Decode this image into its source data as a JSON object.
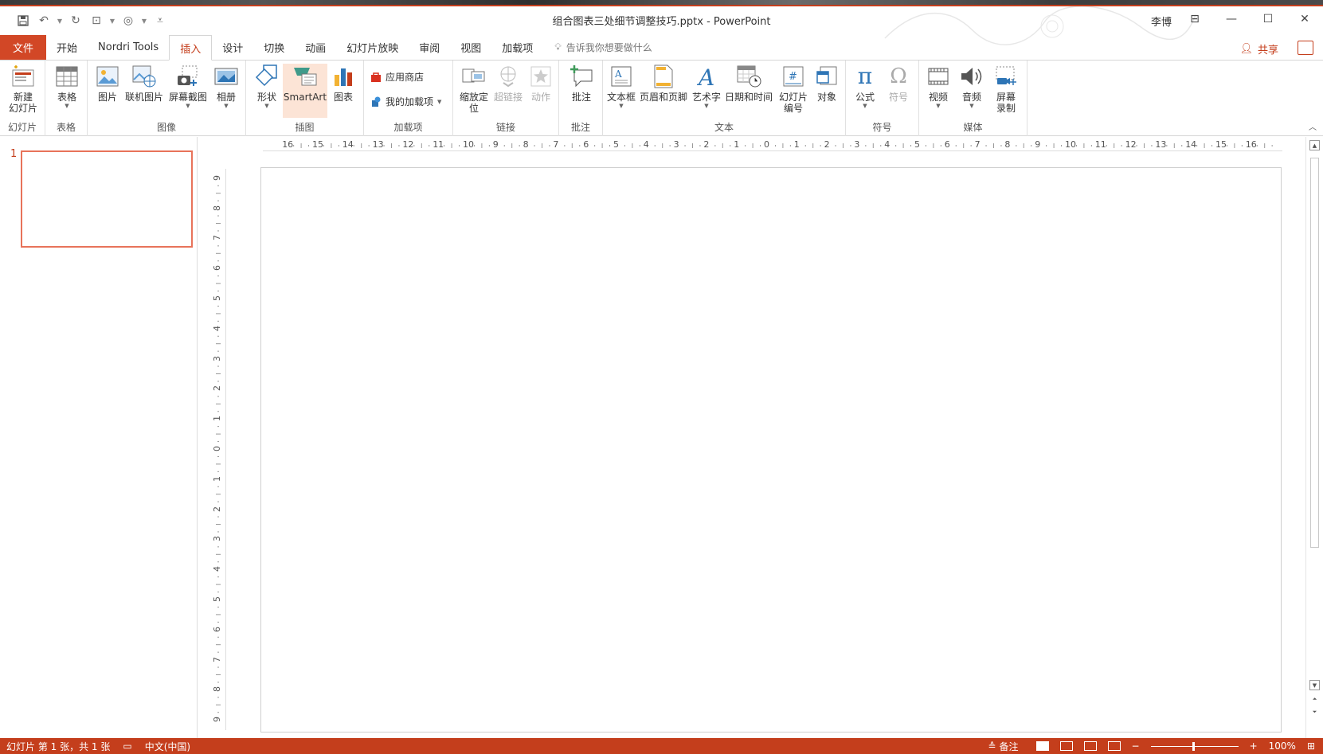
{
  "window": {
    "title": "组合图表三处细节调整技巧.pptx  -  PowerPoint",
    "user": "李博"
  },
  "tabs": [
    {
      "label": "文件",
      "kind": "file"
    },
    {
      "label": "开始"
    },
    {
      "label": "Nordri Tools"
    },
    {
      "label": "插入",
      "active": true
    },
    {
      "label": "设计"
    },
    {
      "label": "切换"
    },
    {
      "label": "动画"
    },
    {
      "label": "幻灯片放映"
    },
    {
      "label": "审阅"
    },
    {
      "label": "视图"
    },
    {
      "label": "加载项"
    }
  ],
  "tellme": "告诉我你想要做什么",
  "share": "共享",
  "ribbon": {
    "groups": {
      "slides": "幻灯片",
      "tables": "表格",
      "images": "图像",
      "illustrations": "插图",
      "addins": "加载项",
      "links": "链接",
      "comments": "批注",
      "text": "文本",
      "symbols": "符号",
      "media": "媒体"
    },
    "buttons": {
      "new_slide_1": "新建",
      "new_slide_2": "幻灯片",
      "table": "表格",
      "picture": "图片",
      "online_picture": "联机图片",
      "screenshot": "屏幕截图",
      "album": "相册",
      "shapes": "形状",
      "smartart": "SmartArt",
      "chart": "图表",
      "store": "应用商店",
      "my_addins": "我的加载项",
      "zoom_1": "缩放定",
      "zoom_2": "位",
      "hyperlink": "超链接",
      "action": "动作",
      "comment": "批注",
      "textbox": "文本框",
      "header_footer": "页眉和页脚",
      "wordart": "艺术字",
      "datetime": "日期和时间",
      "slide_num_1": "幻灯片",
      "slide_num_2": "编号",
      "object": "对象",
      "equation": "公式",
      "symbol": "符号",
      "video": "视频",
      "audio": "音频",
      "screen_rec_1": "屏幕",
      "screen_rec_2": "录制"
    }
  },
  "thumbnails": [
    {
      "number": "1"
    }
  ],
  "status": {
    "slide_info": "幻灯片 第 1 张，共 1 张",
    "language": "中文(中国)",
    "notes": "备注",
    "zoom": "100%"
  },
  "colors": {
    "accent": "#c43e1c",
    "thumb_border": "#e8735a"
  }
}
